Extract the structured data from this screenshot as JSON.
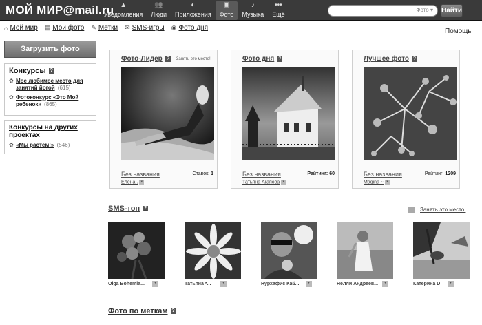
{
  "header": {
    "logo": "МОЙ МИР@mail.ru",
    "nav": [
      {
        "label": "Уведомления",
        "icon": "▲",
        "icon_name": "bell-icon"
      },
      {
        "label": "Люди",
        "icon": "👥",
        "icon_name": "people-icon"
      },
      {
        "label": "Приложения",
        "icon": "◐",
        "icon_name": "apps-icon"
      },
      {
        "label": "Фото",
        "icon": "▣",
        "icon_name": "photo-icon"
      },
      {
        "label": "Музыка",
        "icon": "♪",
        "icon_name": "music-icon"
      },
      {
        "label": "Ещё",
        "icon": "•••",
        "icon_name": "more-icon"
      }
    ],
    "search_scope": "Фото ▾",
    "search_button": "Найти"
  },
  "subnav": [
    {
      "label": "Мой мир",
      "icon": "⌂"
    },
    {
      "label": "Мои фото",
      "icon": "▤"
    },
    {
      "label": "Метки",
      "icon": "✎"
    },
    {
      "label": "SMS-игры",
      "icon": "✉"
    },
    {
      "label": "Фото дня",
      "icon": "◉"
    }
  ],
  "help": "Помощь",
  "sidebar": {
    "upload_button": "Загрузить фото",
    "contests": {
      "title": "Конкурсы",
      "items": [
        {
          "text": "Мое любимое место для занятий йогой",
          "count": "(615)"
        },
        {
          "text": "Фотоконкурс «Это Мой ребенок»",
          "count": "(865)"
        }
      ]
    },
    "other_contests": {
      "title": "Конкурсы на других проектах",
      "items": [
        {
          "text": "«Мы растём!»",
          "count": "(546)"
        }
      ]
    }
  },
  "cards": [
    {
      "title": "Фото-Лидер",
      "link": "Занять это место!",
      "name": "Без названия",
      "stat_label": "Ставок:",
      "stat_value": "1",
      "author": "Елена ."
    },
    {
      "title": "Фото дня",
      "link": "",
      "name": "Без названия",
      "stat_label": "Рейтинг:",
      "stat_value": "60",
      "author": "Татьяна Агапова"
    },
    {
      "title": "Лучшее фото",
      "link": "",
      "name": "Без названия",
      "stat_label": "Рейтинг:",
      "stat_value": "1209",
      "author": "Magina ~"
    }
  ],
  "sms_top": {
    "title": "SMS-топ",
    "link": "Занять это место!",
    "thumbs": [
      {
        "name": "Olga Bohemia..."
      },
      {
        "name": "Татьяна *..."
      },
      {
        "name": "Нурхафис Каб..."
      },
      {
        "name": "Нелли Андреев..."
      },
      {
        "name": "Катерина D"
      }
    ]
  },
  "tags_section": {
    "title": "Фото по меткам"
  }
}
